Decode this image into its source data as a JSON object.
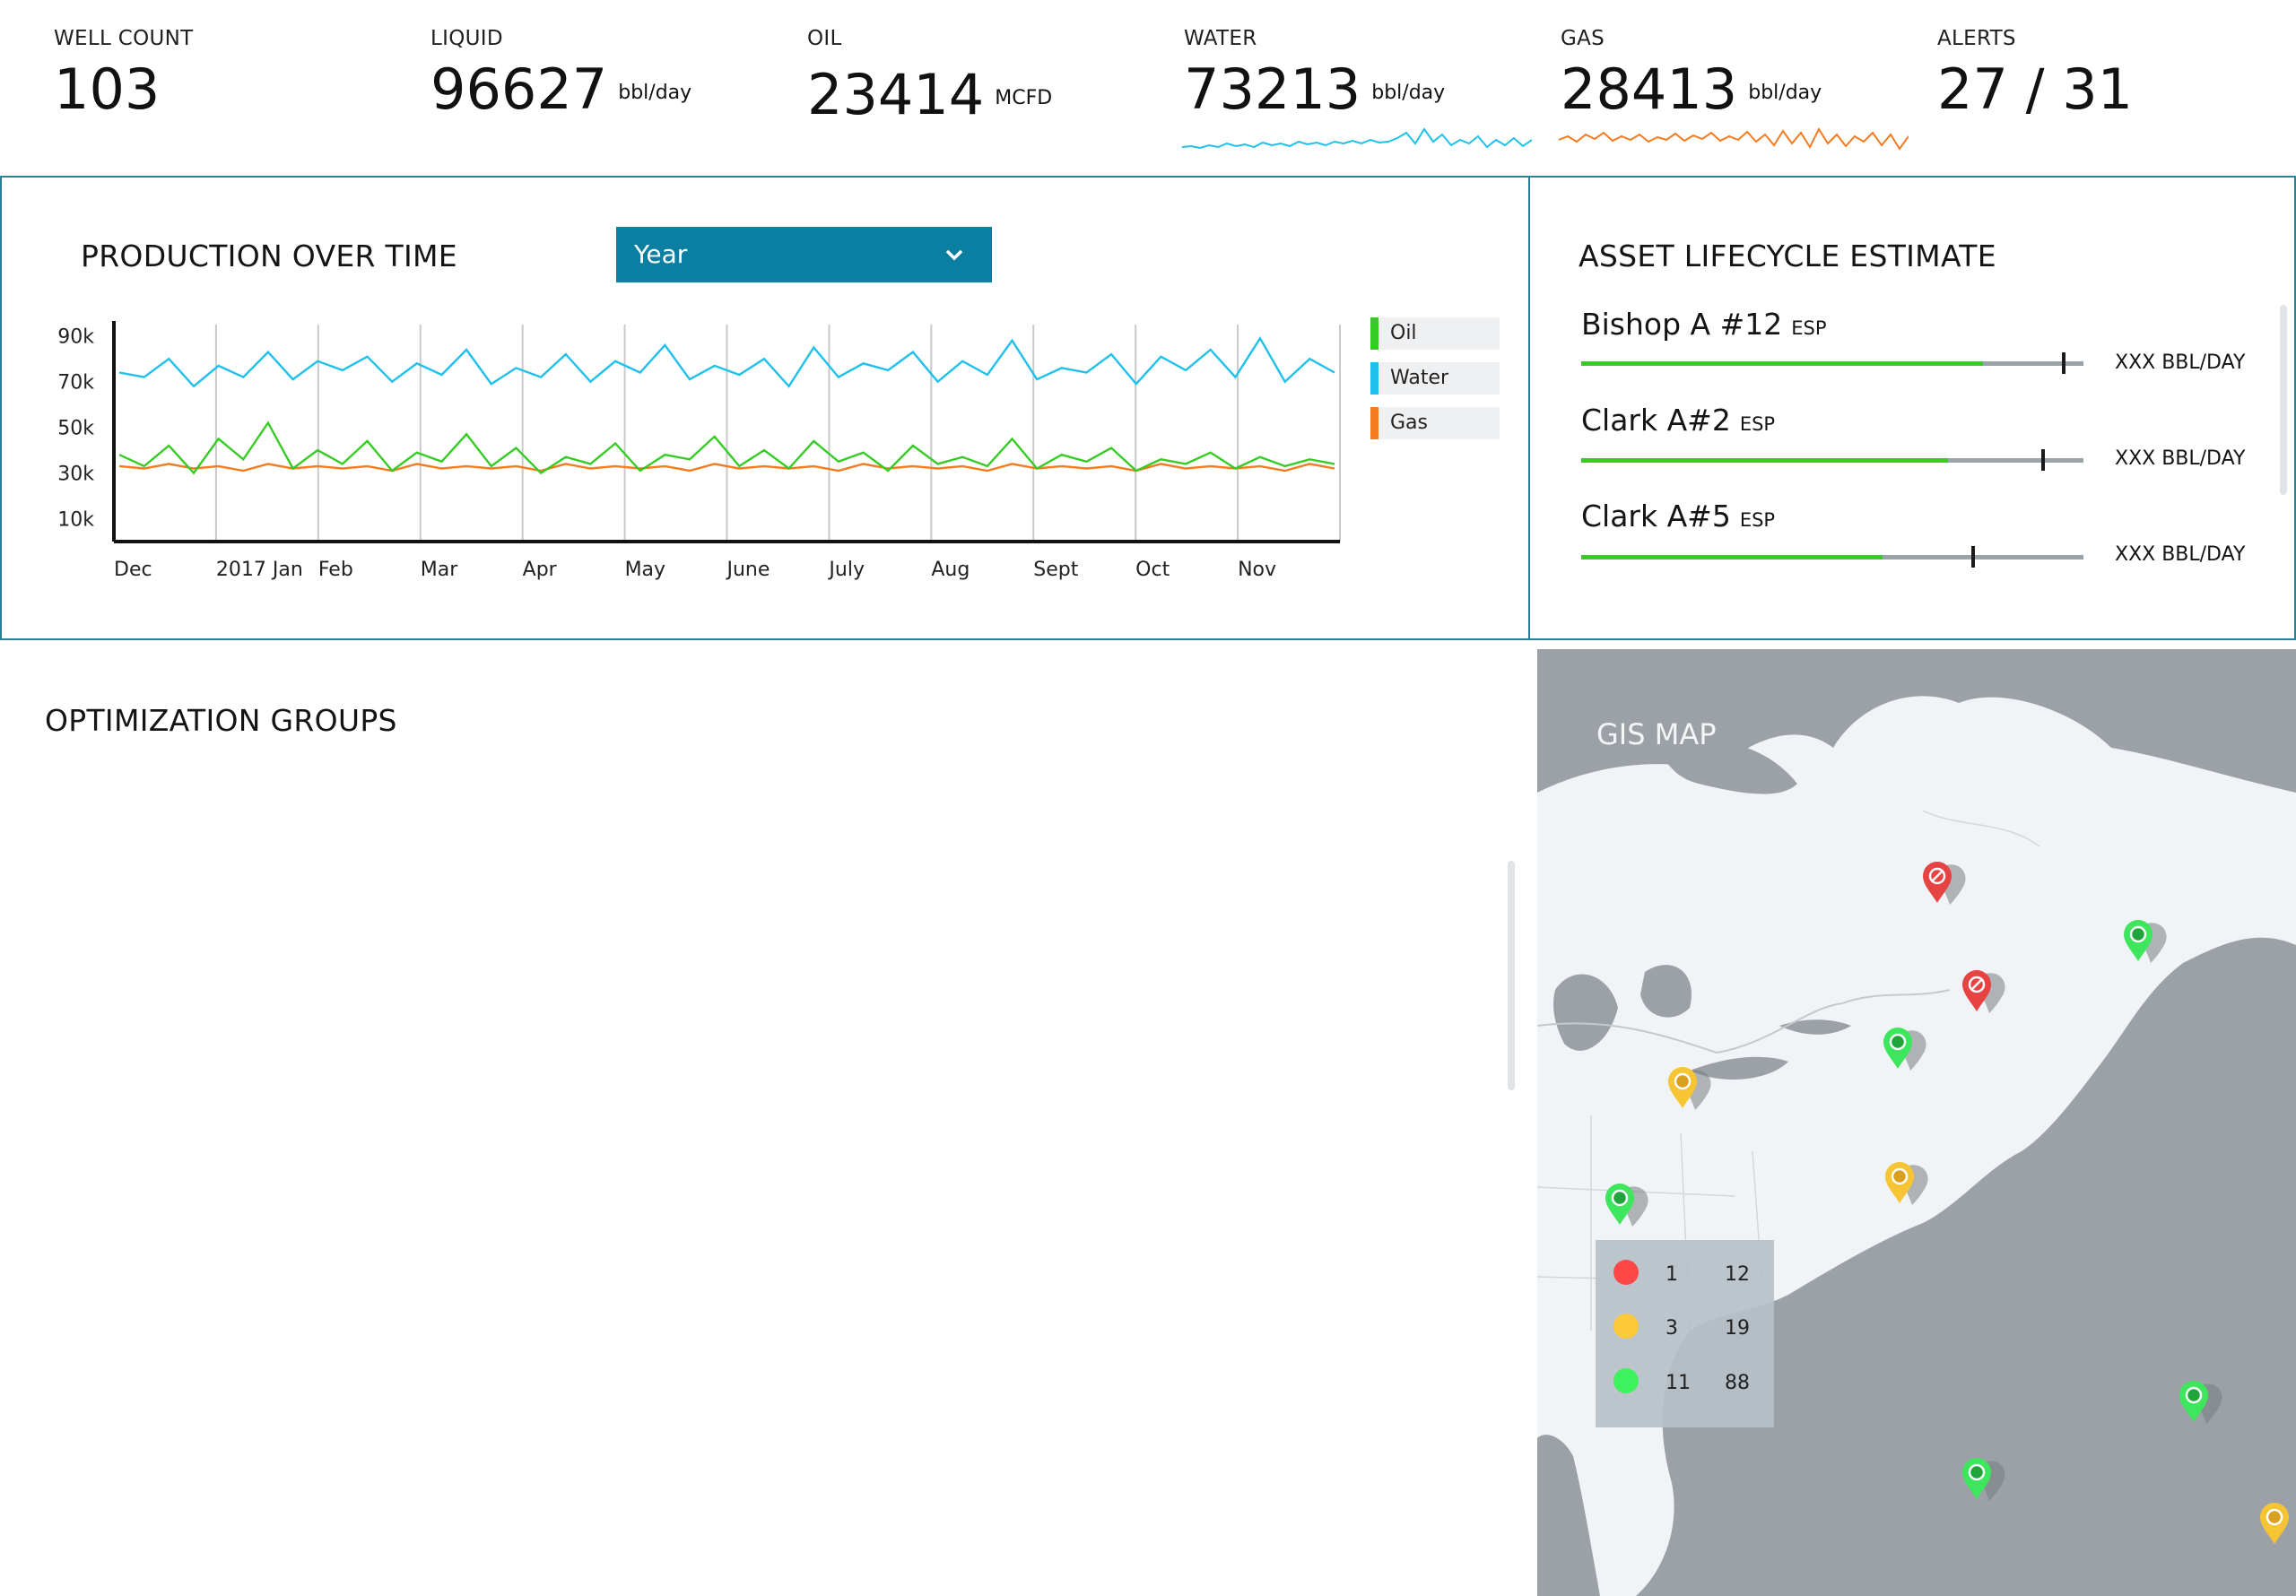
{
  "kpis": {
    "well_count": {
      "label": "WELL COUNT",
      "value": "103"
    },
    "liquid": {
      "label": "LIQUID",
      "value": "96627",
      "unit": "bbl/day"
    },
    "oil": {
      "label": "OIL",
      "value": "23414",
      "unit": "MCFD"
    },
    "water": {
      "label": "WATER",
      "value": "73213",
      "unit": "bbl/day"
    },
    "gas": {
      "label": "GAS",
      "value": "28413",
      "unit": "bbl/day"
    },
    "alerts": {
      "label": "ALERTS",
      "value": "27 / 31"
    }
  },
  "production": {
    "title": "PRODUCTION OVER TIME",
    "period_select": "Year",
    "legend": [
      {
        "name": "Oil",
        "color": "#37cc25"
      },
      {
        "name": "Water",
        "color": "#20c0ec"
      },
      {
        "name": "Gas",
        "color": "#f47b20"
      }
    ]
  },
  "chart_data": {
    "type": "line",
    "x_ticks": [
      "Dec",
      "2017 Jan",
      "Feb",
      "Mar",
      "Apr",
      "May",
      "June",
      "July",
      "Aug",
      "Sept",
      "Oct",
      "Nov"
    ],
    "y_ticks": [
      "90k",
      "70k",
      "50k",
      "30k",
      "10k"
    ],
    "ylim": [
      0,
      95000
    ],
    "grid": "vertical",
    "legend_position": "right",
    "series": [
      {
        "name": "Water",
        "color": "#20c0ec",
        "values": [
          74000,
          72000,
          80000,
          68000,
          77000,
          72000,
          83000,
          71000,
          79000,
          75000,
          81000,
          70000,
          78000,
          73000,
          84000,
          69000,
          76000,
          72000,
          82000,
          70000,
          79000,
          74000,
          86000,
          71000,
          77000,
          73000,
          80000,
          68000,
          85000,
          72000,
          78000,
          75000,
          83000,
          70000,
          79000,
          73000,
          88000,
          71000,
          76000,
          74000,
          82000,
          69000,
          81000,
          75000,
          84000,
          72000,
          89000,
          70000,
          80000,
          74000
        ]
      },
      {
        "name": "Oil",
        "color": "#37cc25",
        "values": [
          38000,
          33000,
          42000,
          30000,
          45000,
          36000,
          52000,
          32000,
          40000,
          34000,
          44000,
          31000,
          39000,
          35000,
          47000,
          33000,
          41000,
          30000,
          37000,
          34000,
          43000,
          31000,
          38000,
          36000,
          46000,
          33000,
          40000,
          32000,
          44000,
          35000,
          39000,
          31000,
          42000,
          34000,
          37000,
          33000,
          45000,
          32000,
          38000,
          35000,
          41000,
          31000,
          36000,
          34000,
          39000,
          32000,
          37000,
          33000,
          36000,
          34000
        ]
      },
      {
        "name": "Gas",
        "color": "#f47b20",
        "values": [
          33000,
          32000,
          34000,
          32000,
          33000,
          31000,
          34000,
          32000,
          33000,
          32000,
          33000,
          31000,
          34000,
          32000,
          33000,
          32000,
          33000,
          31000,
          34000,
          32000,
          33000,
          32000,
          33000,
          31000,
          34000,
          32000,
          33000,
          32000,
          33000,
          31000,
          34000,
          32000,
          33000,
          32000,
          33000,
          31000,
          34000,
          32000,
          33000,
          32000,
          33000,
          31000,
          34000,
          32000,
          33000,
          32000,
          33000,
          31000,
          34000,
          32000
        ]
      }
    ]
  },
  "asset_lifecycle": {
    "title": "ASSET LIFECYCLE ESTIMATE",
    "items": [
      {
        "name": "Bishop A #12",
        "type": "ESP",
        "rate": "XXX BBL/DAY",
        "progress": 0.8,
        "marker": 0.96
      },
      {
        "name": "Clark A#2",
        "type": "ESP",
        "rate": "XXX BBL/DAY",
        "progress": 0.73,
        "marker": 0.92
      },
      {
        "name": "Clark A#5",
        "type": "ESP",
        "rate": "XXX BBL/DAY",
        "progress": 0.6,
        "marker": 0.78
      }
    ]
  },
  "optimization": {
    "title": "OPTIMIZATION GROUPS"
  },
  "map": {
    "title": "GIS MAP",
    "legend": [
      {
        "color": "#ff4747",
        "count": "1",
        "total": "12"
      },
      {
        "color": "#fcc93a",
        "count": "3",
        "total": "19"
      },
      {
        "color": "#3df25e",
        "count": "11",
        "total": "88"
      }
    ],
    "status_colors": {
      "alert": "#e84343",
      "warning": "#f7c534",
      "ok": "#3ee65e"
    }
  },
  "icons": [
    "chevron-down-icon",
    "map-pin-icon",
    "alert-pin-icon"
  ]
}
